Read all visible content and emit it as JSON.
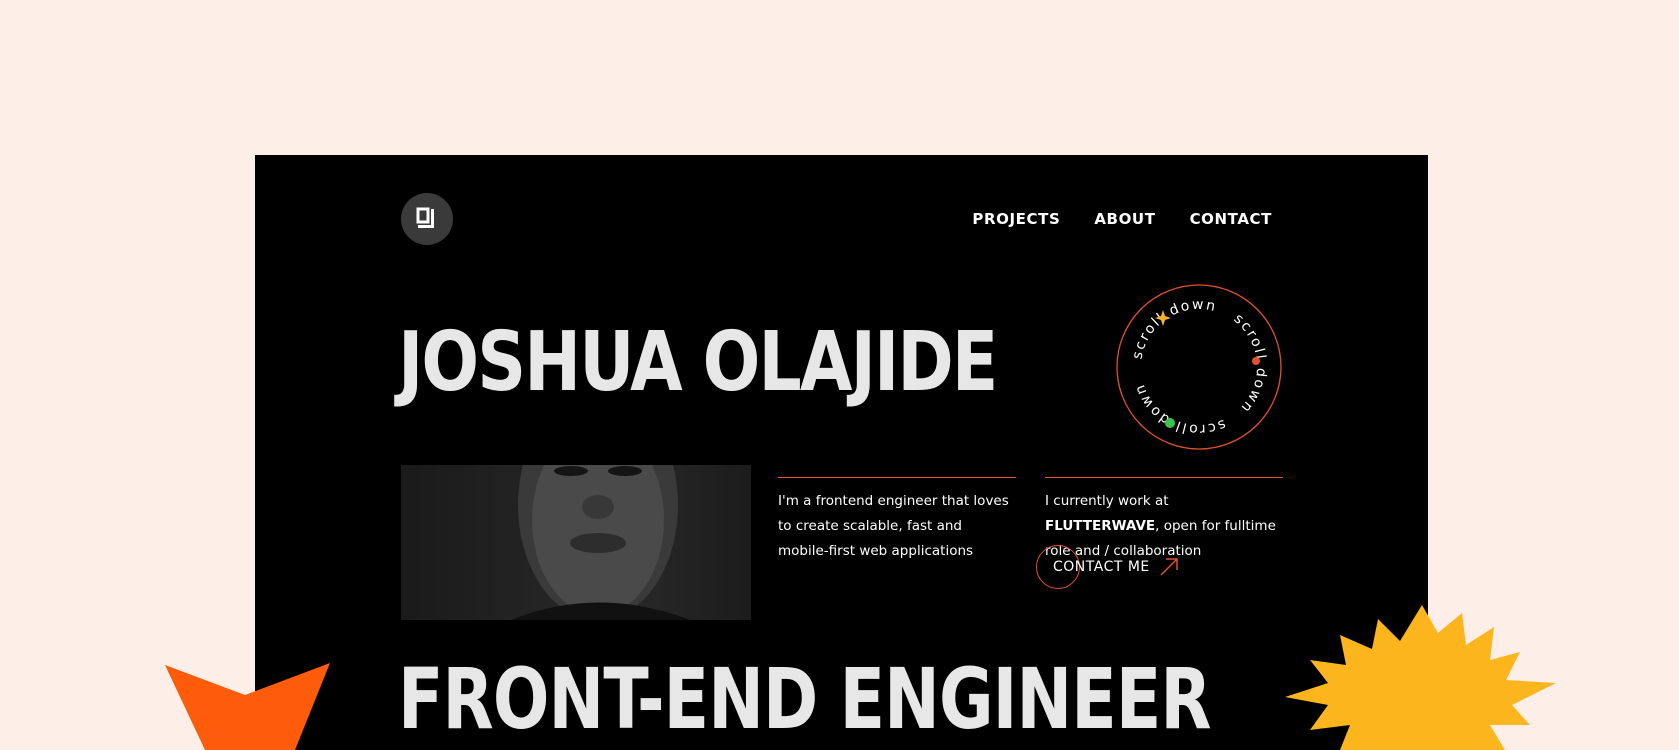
{
  "nav": {
    "logo_alt": "JO",
    "items": [
      {
        "label": "PROJECTS"
      },
      {
        "label": "ABOUT"
      },
      {
        "label": "CONTACT"
      }
    ]
  },
  "hero": {
    "name": "JOSHUA OLAJIDE",
    "badge_text": "scroll down",
    "badge_emoji": "😜",
    "intro": "I'm a frontend engineer that loves to create scalable, fast and mobile-first web applications",
    "work_prefix": "I currently work at ",
    "work_company": "FLUTTERWAVE",
    "work_suffix": ", open for fulltime role and / collaboration",
    "contact_label": "CONTACT ME",
    "role_title": "FRONT-END ENGINEER"
  },
  "colors": {
    "page_bg": "#fdeee7",
    "frame_bg": "#000000",
    "accent": "#e0512c",
    "star_orange": "#fe5b0a",
    "star_yellow": "#fdb51e"
  }
}
